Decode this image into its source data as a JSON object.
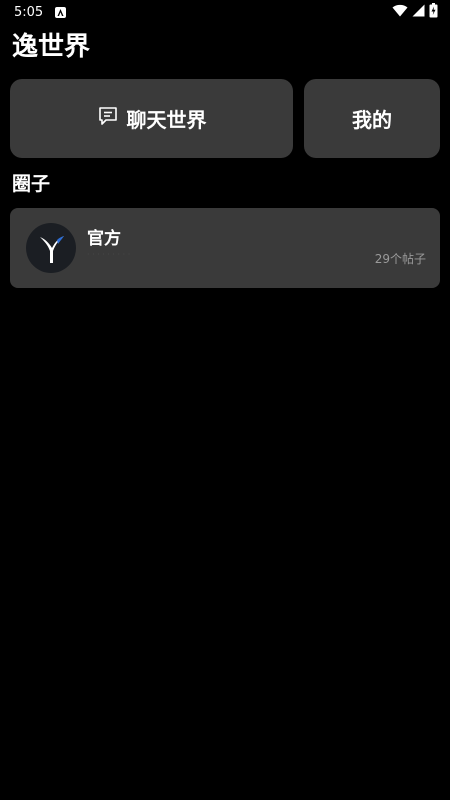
{
  "status_bar": {
    "time": "5:05"
  },
  "app": {
    "title": "逸世界"
  },
  "nav": {
    "chat_world_label": "聊天世界",
    "mine_label": "我的"
  },
  "circles": {
    "section_title": "圈子",
    "items": [
      {
        "name": "官方",
        "description": "· · · · · · · · ·",
        "post_count": "29个帖子"
      }
    ]
  },
  "colors": {
    "background": "#000000",
    "card": "#3a3a3a",
    "text": "#ffffff",
    "muted_text": "#9a9a9a",
    "avatar_bg": "#1b1e23",
    "logo_accent": "#2f6fd6"
  },
  "icons": {
    "chat": "message-square-icon",
    "notification": "notification-a-icon",
    "wifi": "wifi-icon",
    "signal": "signal-icon",
    "battery": "battery-icon"
  }
}
